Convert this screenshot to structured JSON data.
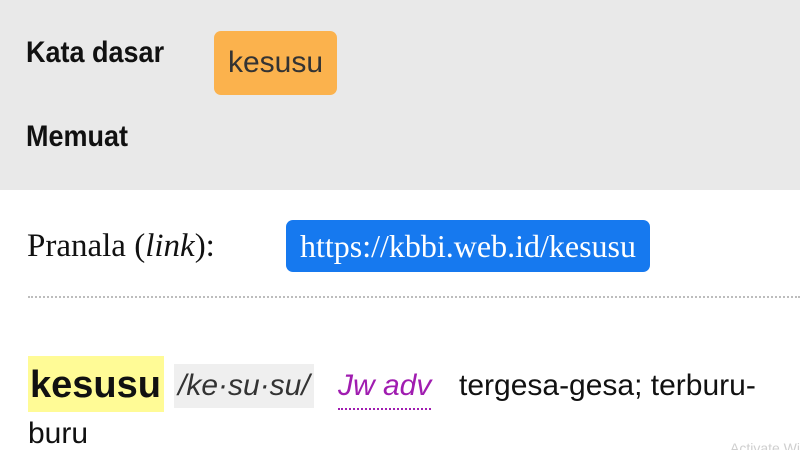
{
  "header": {
    "root_word_label": "Kata dasar",
    "root_word_value": "kesusu",
    "contains_label": "Memuat"
  },
  "link": {
    "label_prefix": "Pranala (",
    "label_italic": "link",
    "label_suffix": "):",
    "url": "https://kbbi.web.id/kesusu"
  },
  "entry": {
    "headword": "kesusu",
    "pronunciation": "/ke·su·su/",
    "grammar": "Jw adv",
    "definition_line1": "tergesa-gesa; terburu-",
    "definition_line2": "buru"
  },
  "watermark": {
    "text": "Activate Wi"
  },
  "colors": {
    "badge": "#fbb24d",
    "url_pill": "#1679ef",
    "headword_highlight": "#fffb96",
    "grammar": "#a01db0",
    "panel": "#e9e9e9"
  }
}
